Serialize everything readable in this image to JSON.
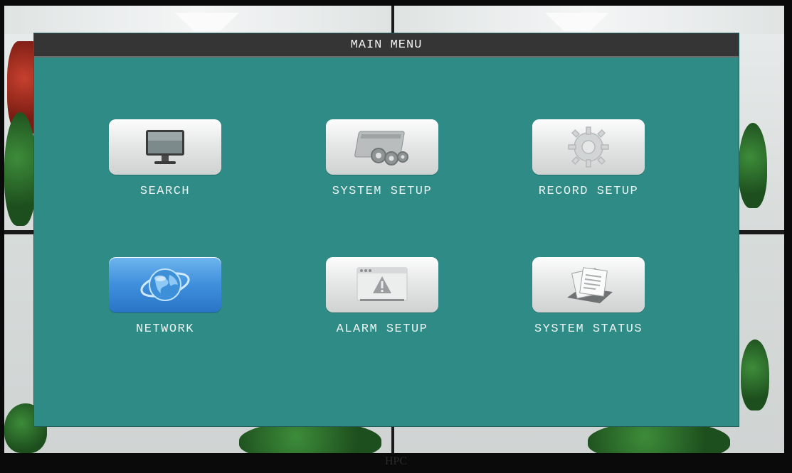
{
  "menu": {
    "title": "MAIN MENU",
    "items": [
      {
        "label": "SEARCH",
        "icon": "monitor-icon",
        "selected": false
      },
      {
        "label": "SYSTEM SETUP",
        "icon": "system-setup-gears-icon",
        "selected": false
      },
      {
        "label": "RECORD SETUP",
        "icon": "gear-icon",
        "selected": false
      },
      {
        "label": "NETWORK",
        "icon": "globe-icon",
        "selected": true
      },
      {
        "label": "ALARM SETUP",
        "icon": "alarm-warning-icon",
        "selected": false
      },
      {
        "label": "SYSTEM STATUS",
        "icon": "documents-icon",
        "selected": false
      }
    ]
  },
  "monitor": {
    "brand": "HPC"
  },
  "colors": {
    "menu_background": "#2f8b85",
    "title_bar": "#353535",
    "selected_tile": "#3f8fdc"
  }
}
